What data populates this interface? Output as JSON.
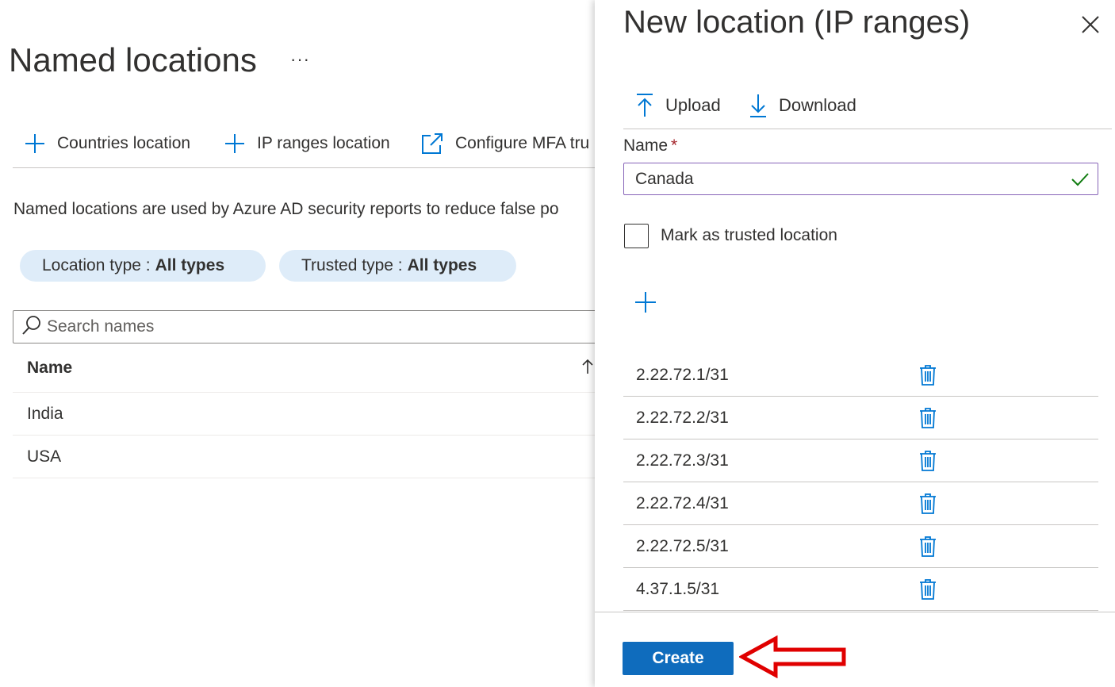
{
  "page": {
    "title": "Named locations",
    "more_label": "···",
    "commands": {
      "countries": "Countries location",
      "ip_ranges": "IP ranges location",
      "configure_mfa": "Configure MFA tru"
    },
    "description": "Named locations are used by Azure AD security reports to reduce false po",
    "filters": {
      "location_type": {
        "label": "Location type :",
        "value": "All types"
      },
      "trusted_type": {
        "label": "Trusted type :",
        "value": "All types"
      }
    },
    "search": {
      "placeholder": "Search names"
    },
    "table": {
      "header": "Name",
      "rows": [
        "India",
        "USA"
      ]
    }
  },
  "panel": {
    "title": "New location (IP ranges)",
    "toolbar": {
      "upload": "Upload",
      "download": "Download"
    },
    "name_label": "Name",
    "required_mark": "*",
    "name_value": "Canada",
    "trusted_checkbox_label": "Mark as trusted location",
    "trusted_checked": false,
    "ip_ranges": [
      "2.22.72.1/31",
      "2.22.72.2/31",
      "2.22.72.3/31",
      "2.22.72.4/31",
      "2.22.72.5/31",
      "4.37.1.5/31"
    ],
    "create_label": "Create"
  },
  "colors": {
    "accent": "#0078d4",
    "primary_button": "#0f6cbd",
    "pill_background": "#deecf9",
    "valid_check": "#107c10",
    "field_border": "#8764b8",
    "annotation_arrow": "#e00000"
  },
  "icons": {
    "add": "plus-icon",
    "external_link": "external-link-icon",
    "search": "search-icon",
    "sort": "sort-up-icon",
    "close": "close-icon",
    "upload": "upload-icon",
    "download": "download-icon",
    "valid": "checkmark-icon",
    "delete": "trash-icon"
  }
}
